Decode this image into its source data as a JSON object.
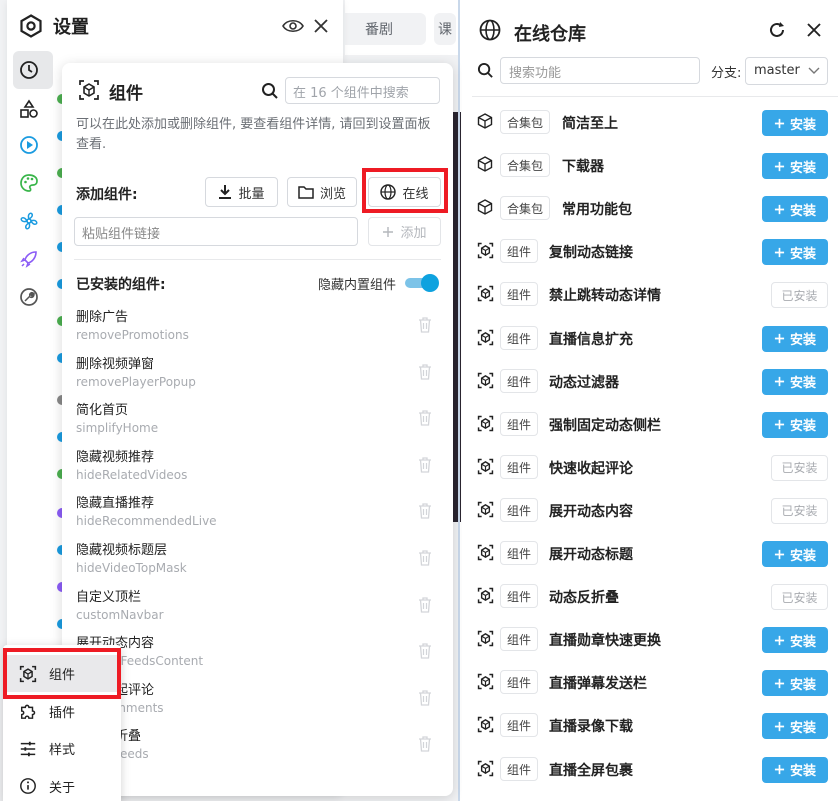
{
  "background": {
    "tabs": [
      "番剧",
      "课"
    ]
  },
  "settings": {
    "title": "设置"
  },
  "component_panel": {
    "title": "组件",
    "search_placeholder": "在 16 个组件中搜索",
    "description": "可以在此处添加或删除组件, 要查看组件详情, 请回到设置面板查看.",
    "add_label": "添加组件:",
    "batch_label": "批量",
    "browse_label": "浏览",
    "online_label": "在线",
    "link_placeholder": "粘贴组件链接",
    "add_button": "添加",
    "installed_label": "已安装的组件:",
    "hide_builtin_label": "隐藏内置组件",
    "hide_builtin_on": true,
    "installed": [
      {
        "name": "删除广告",
        "id": "removePromotions"
      },
      {
        "name": "删除视频弹窗",
        "id": "removePlayerPopup"
      },
      {
        "name": "简化首页",
        "id": "simplifyHome"
      },
      {
        "name": "隐藏视频推荐",
        "id": "hideRelatedVideos"
      },
      {
        "name": "隐藏直播推荐",
        "id": "hideRecommendedLive"
      },
      {
        "name": "隐藏视频标题层",
        "id": "hideVideoTopMask"
      },
      {
        "name": "自定义顶栏",
        "id": "customNavbar"
      },
      {
        "name": "展开动态内容",
        "id": "expandFeedsContent"
      },
      {
        "name": "快速收起评论",
        "id": "foldComments"
      },
      {
        "name": "动态反折叠",
        "id": "unfoldFeeds"
      }
    ]
  },
  "menu": {
    "items": [
      {
        "label": "组件",
        "icon": "component-icon",
        "active": true
      },
      {
        "label": "插件",
        "icon": "puzzle-icon",
        "active": false
      },
      {
        "label": "样式",
        "icon": "sliders-icon",
        "active": false
      },
      {
        "label": "关于",
        "icon": "info-icon",
        "active": false
      }
    ]
  },
  "online": {
    "title": "在线仓库",
    "search_placeholder": "搜索功能",
    "branch_label": "分支:",
    "branch_value": "master",
    "install_label": "安装",
    "installed_label": "已安装",
    "items": [
      {
        "type": "合集包",
        "name": "简洁至上",
        "installed": false
      },
      {
        "type": "合集包",
        "name": "下载器",
        "installed": false
      },
      {
        "type": "合集包",
        "name": "常用功能包",
        "installed": false
      },
      {
        "type": "组件",
        "name": "复制动态链接",
        "installed": false
      },
      {
        "type": "组件",
        "name": "禁止跳转动态详情",
        "installed": true
      },
      {
        "type": "组件",
        "name": "直播信息扩充",
        "installed": false
      },
      {
        "type": "组件",
        "name": "动态过滤器",
        "installed": false
      },
      {
        "type": "组件",
        "name": "强制固定动态侧栏",
        "installed": false
      },
      {
        "type": "组件",
        "name": "快速收起评论",
        "installed": true
      },
      {
        "type": "组件",
        "name": "展开动态内容",
        "installed": true
      },
      {
        "type": "组件",
        "name": "展开动态标题",
        "installed": false
      },
      {
        "type": "组件",
        "name": "动态反折叠",
        "installed": true
      },
      {
        "type": "组件",
        "name": "直播勋章快速更换",
        "installed": false
      },
      {
        "type": "组件",
        "name": "直播弹幕发送栏",
        "installed": false
      },
      {
        "type": "组件",
        "name": "直播录像下载",
        "installed": false
      },
      {
        "type": "组件",
        "name": "直播全屏包裹",
        "installed": false
      }
    ]
  },
  "colors": {
    "accent": "#37a7e8",
    "highlight": "#ee1b24"
  }
}
